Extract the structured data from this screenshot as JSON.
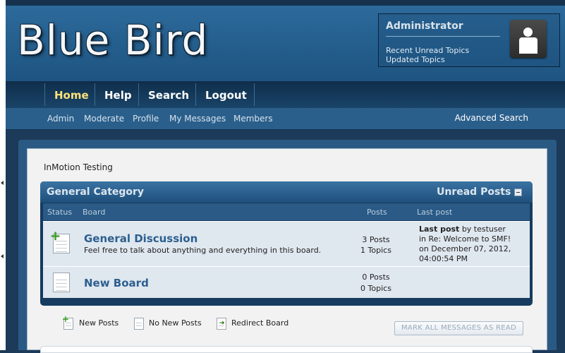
{
  "header": {
    "logo_text": "Blue Bird",
    "user": {
      "name": "Administrator",
      "links": [
        "Recent Unread Topics",
        "Updated Topics"
      ]
    }
  },
  "main_nav": [
    {
      "label": "Home",
      "active": true
    },
    {
      "label": "Help"
    },
    {
      "label": "Search"
    },
    {
      "label": "Logout"
    }
  ],
  "sub_nav": {
    "items": [
      "Admin",
      "Moderate",
      "Profile",
      "My Messages",
      "Members"
    ],
    "advanced_search": "Advanced Search"
  },
  "forum": {
    "title": "InMotion Testing",
    "category": {
      "name": "General Category",
      "unread_posts": "Unread Posts",
      "columns": {
        "status": "Status",
        "board": "Board",
        "posts": "Posts",
        "last_post": "Last post"
      },
      "boards": [
        {
          "icon": "board-new-posts-icon",
          "name": "General Discussion",
          "description": "Feel free to talk about anything and everything in this board.",
          "posts": "3 Posts",
          "topics": "1 Topics",
          "last_post": {
            "label": "Last post",
            "by": "by testuser",
            "in": "in Re: Welcome to SMF!",
            "on": "on December 07, 2012,",
            "time": "04:00:54 PM"
          }
        },
        {
          "icon": "board-no-new-posts-icon",
          "name": "New Board",
          "posts": "0 Posts",
          "topics": "0 Topics"
        }
      ]
    },
    "legend": {
      "new_posts": "New Posts",
      "no_new_posts": "No New Posts",
      "redirect_board": "Redirect Board"
    },
    "mark_all_read": "MARK ALL MESSAGES AS READ"
  },
  "colors": {
    "accent_active_nav": "#ffe27a",
    "board_link": "#2c5f8f",
    "header_blue": "#2d6a9b"
  }
}
